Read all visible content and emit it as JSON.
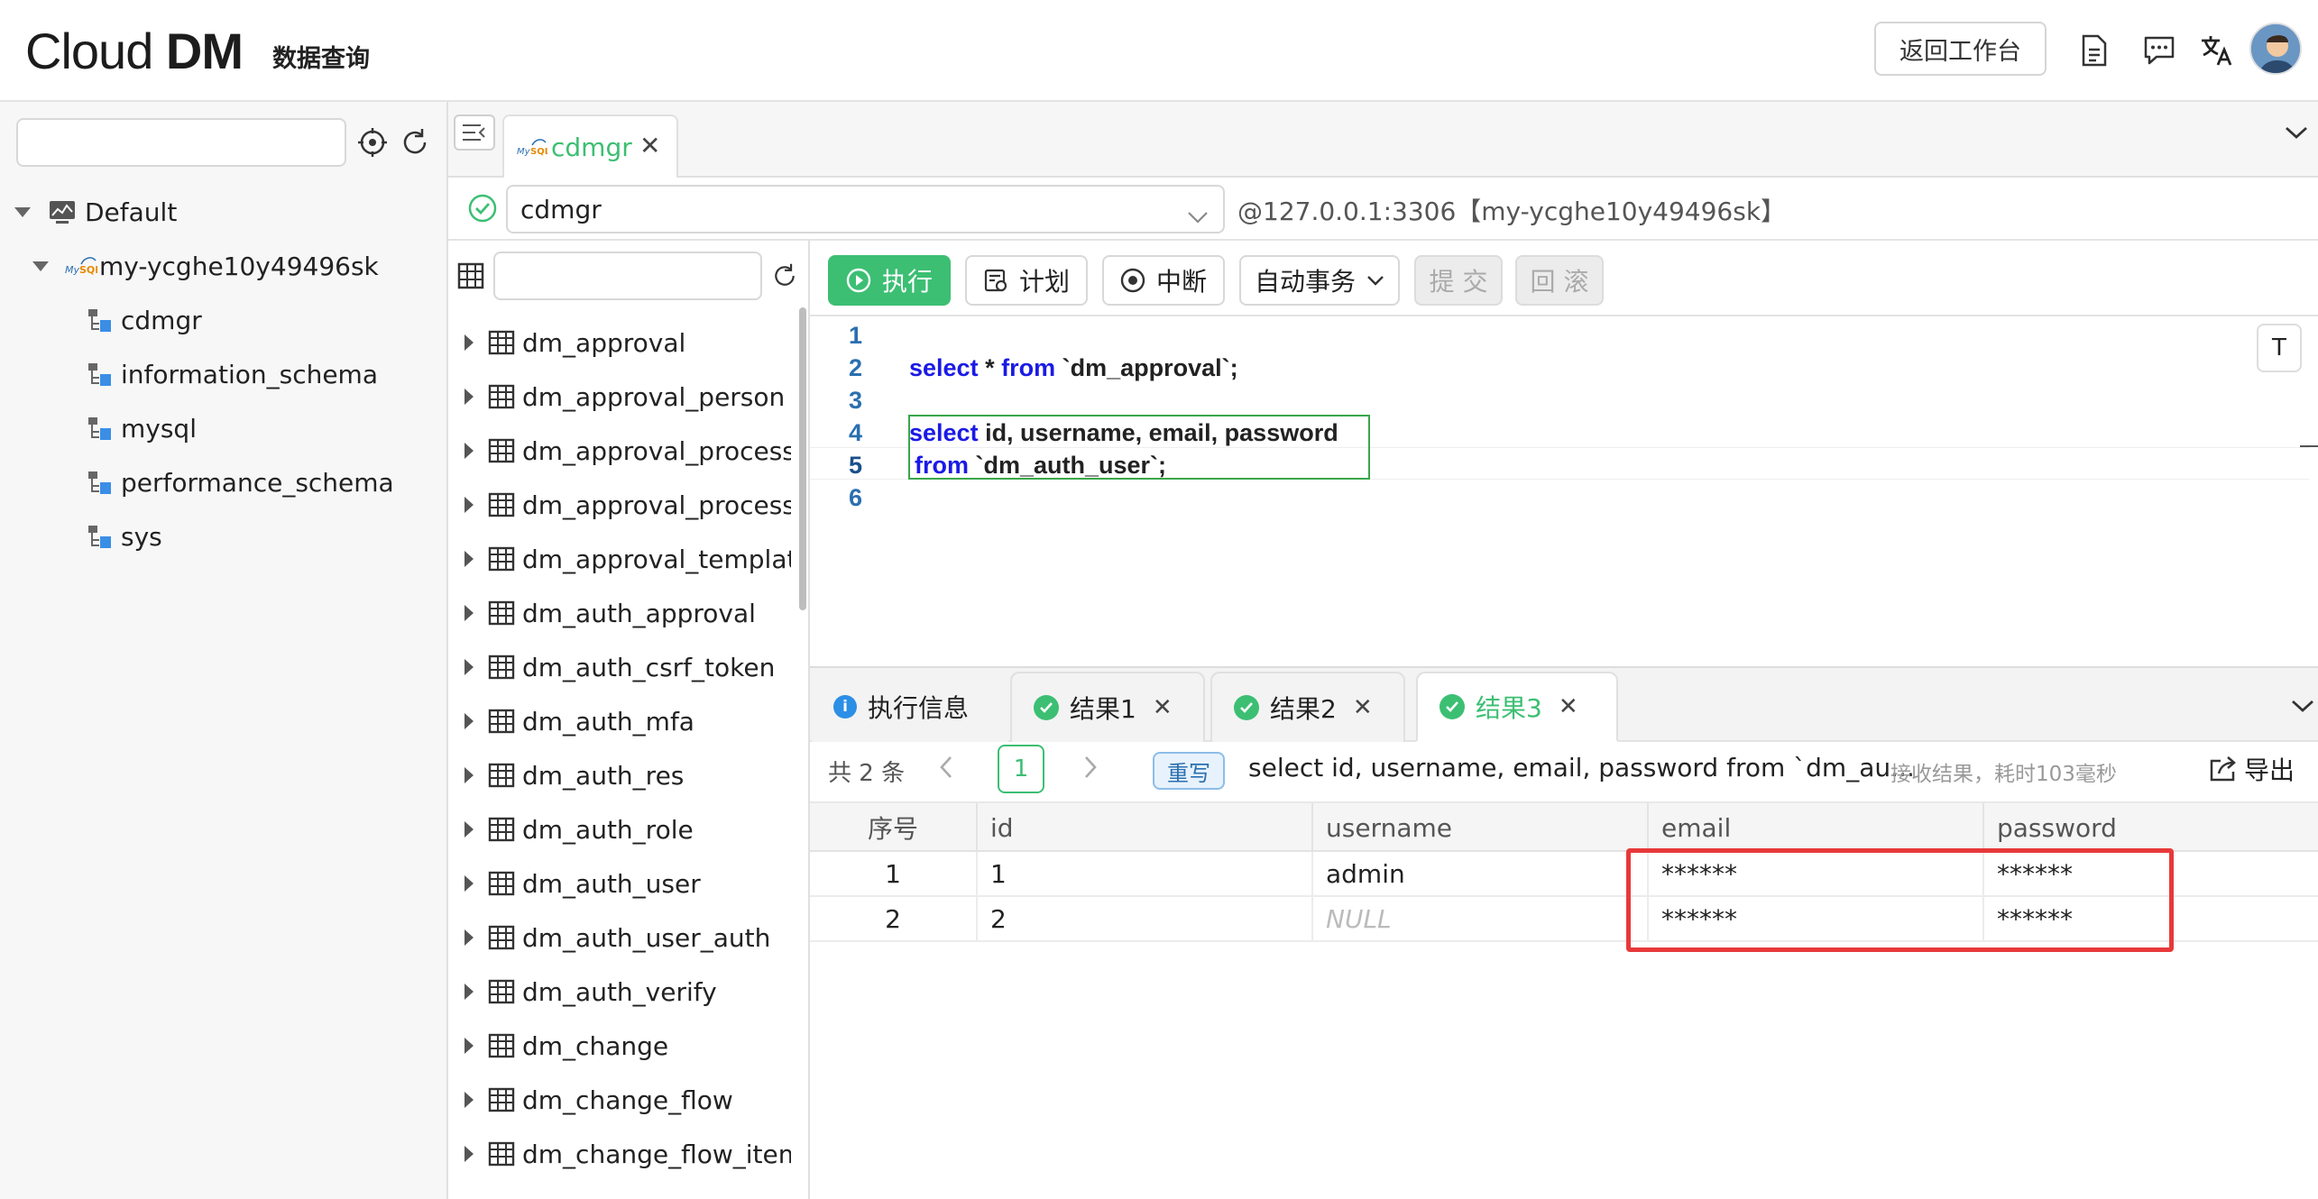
{
  "header": {
    "logo_light": "Cl",
    "logo_o": "o",
    "logo_rest": "ud ",
    "logo_bold": "DM",
    "subtitle": "数据查询",
    "back_button": "返回工作台",
    "icons": [
      "document-icon",
      "chat-icon",
      "translate-icon"
    ]
  },
  "sidebar": {
    "search_value": "",
    "root": "Default",
    "instance": "my-ycghe10y49496sk",
    "databases": [
      "cdmgr",
      "information_schema",
      "mysql",
      "performance_schema",
      "sys"
    ]
  },
  "tabs": {
    "doc_tab": "cdmgr"
  },
  "connection": {
    "database": "cdmgr",
    "address": "@127.0.0.1:3306【my-ycghe10y49496sk】"
  },
  "table_list": {
    "search_value": "",
    "tables": [
      "dm_approval",
      "dm_approval_person",
      "dm_approval_process",
      "dm_approval_process_",
      "dm_approval_template",
      "dm_auth_approval",
      "dm_auth_csrf_token",
      "dm_auth_mfa",
      "dm_auth_res",
      "dm_auth_role",
      "dm_auth_user",
      "dm_auth_user_auth",
      "dm_auth_verify",
      "dm_change",
      "dm_change_flow",
      "dm_change_flow_item"
    ]
  },
  "toolbar": {
    "run": "执行",
    "plan": "计划",
    "stop": "中断",
    "auto_commit": "自动事务",
    "commit": "提 交",
    "rollback": "回 滚"
  },
  "editor": {
    "line_numbers": [
      "1",
      "2",
      "3",
      "4",
      "5",
      "6"
    ],
    "toggle": "T",
    "line2": {
      "kw1": "select",
      "mid": " * ",
      "kw2": "from",
      "rest": " `dm_approval`;"
    },
    "line4": {
      "kw1": "select",
      "rest": " id, username, email, password"
    },
    "line5": {
      "kw1": "from",
      "rest": " `dm_auth_user`;"
    }
  },
  "results": {
    "tabs": [
      "执行信息",
      "结果1",
      "结果2",
      "结果3"
    ],
    "total": "共 2 条",
    "page": "1",
    "rewrite": "重写",
    "sql_preview": "select id, username, email, password from `dm_au...",
    "timing": "接收结果，耗时103毫秒",
    "export": "导出",
    "columns": [
      "序号",
      "id",
      "username",
      "email",
      "password"
    ],
    "rows": [
      [
        "1",
        "1",
        "admin",
        "******",
        "******"
      ],
      [
        "2",
        "2",
        "NULL",
        "******",
        "******"
      ]
    ]
  },
  "colors": {
    "accent_green": "#3cbf73",
    "keyword_blue": "#1a1ae6",
    "highlight_red": "#e8393a"
  }
}
